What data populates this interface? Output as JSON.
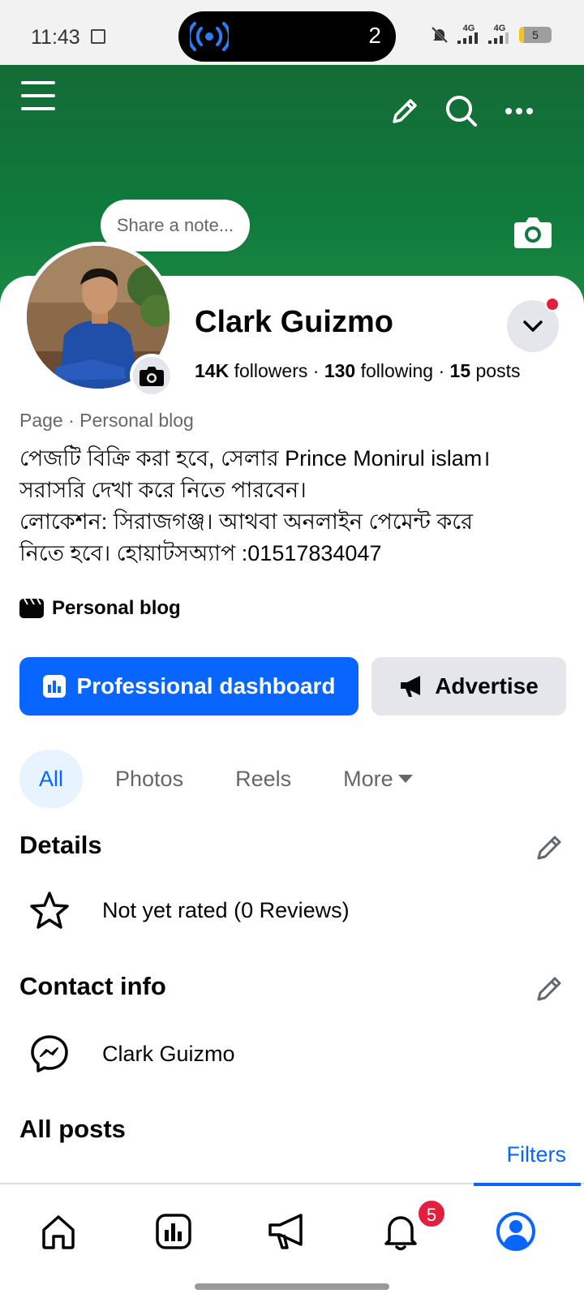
{
  "status_bar": {
    "time": "11:43",
    "call_count": "2",
    "network_left": "4G",
    "network_right": "4G",
    "battery": "5"
  },
  "cover": {
    "note_placeholder": "Share a note...",
    "color": "#0f7a3c"
  },
  "profile": {
    "name": "Clark Guizmo",
    "followers_count": "14K",
    "followers_label": " followers",
    "following_count": "130",
    "following_label": " following",
    "posts_count": "15",
    "posts_label": " posts",
    "separator": " · ",
    "category": "Page · Personal blog",
    "bio_lines": [
      "পেজটি বিক্রি করা হবে, সেলার Prince Monirul islam।",
      "সরাসরি দেখা করে নিতে পারবেন।",
      "লোকেশন: সিরাজগঞ্জ। আথবা অনলাইন পেমেন্ট করে",
      "নিতে হবে। হোয়াটসঅ্যাপ :01517834047"
    ],
    "tag": "Personal blog"
  },
  "actions": {
    "primary_label": "Professional dashboard",
    "secondary_label": "Advertise",
    "accent": "#0866ff"
  },
  "tabs": [
    {
      "label": "All",
      "active": true
    },
    {
      "label": "Photos",
      "active": false
    },
    {
      "label": "Reels",
      "active": false
    },
    {
      "label": "More",
      "active": false
    }
  ],
  "details": {
    "title": "Details",
    "rating_text": "Not yet rated (0 Reviews)"
  },
  "contact": {
    "title": "Contact info",
    "messenger_name": "Clark Guizmo"
  },
  "posts": {
    "title": "All posts",
    "filters_label": "Filters"
  },
  "nav": {
    "notifications_badge": "5",
    "items": [
      "home-icon",
      "dashboard-icon",
      "megaphone-icon",
      "bell-icon",
      "profile-icon"
    ]
  }
}
